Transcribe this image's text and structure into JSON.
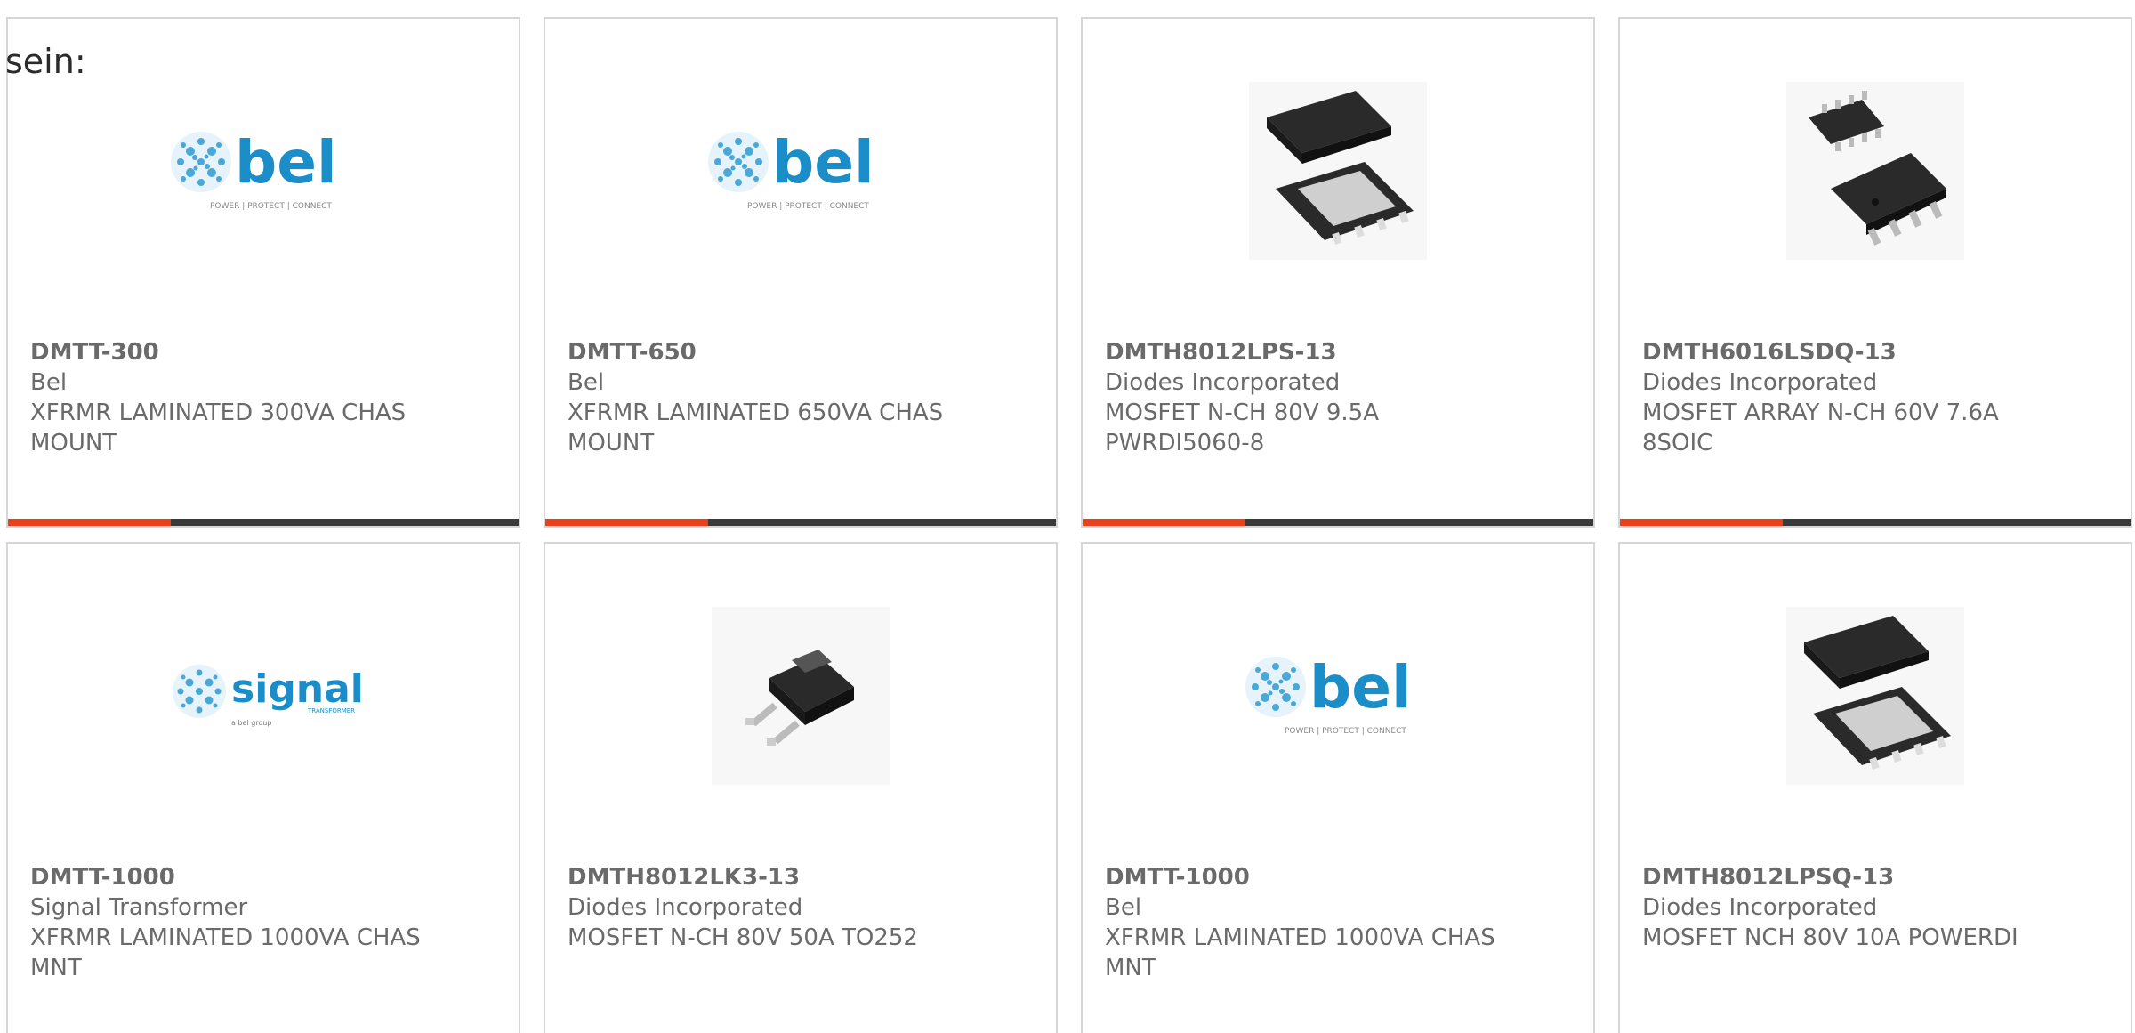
{
  "intro_text": "sein:",
  "colors": {
    "accent_bar": "#e8411d",
    "bar_dark": "#3a3a3a",
    "bel_blue": "#1b8ec9",
    "chip_dark": "#2a2a2a"
  },
  "products": [
    {
      "part": "DMTT-300",
      "maker": "Bel",
      "desc": "XFRMR LAMINATED 300VA CHAS MOUNT",
      "image": "bel-logo",
      "progress_fraction": 0.32
    },
    {
      "part": "DMTT-650",
      "maker": "Bel",
      "desc": "XFRMR LAMINATED 650VA CHAS MOUNT",
      "image": "bel-logo",
      "progress_fraction": 0.32
    },
    {
      "part": "DMTH8012LPS-13",
      "maker": "Diodes Incorporated",
      "desc": "MOSFET N-CH 80V 9.5A PWRDI5060-8",
      "image": "powerdi-chip",
      "progress_fraction": 0.32
    },
    {
      "part": "DMTH6016LSDQ-13",
      "maker": "Diodes Incorporated",
      "desc": "MOSFET ARRAY N-CH 60V 7.6A 8SOIC",
      "image": "soic-chip",
      "progress_fraction": 0.32
    },
    {
      "part": "DMTT-1000",
      "maker": "Signal Transformer",
      "desc": "XFRMR LAMINATED 1000VA CHAS MNT",
      "image": "signal-logo"
    },
    {
      "part": "DMTH8012LK3-13",
      "maker": "Diodes Incorporated",
      "desc": "MOSFET N-CH 80V 50A TO252",
      "image": "to252-chip"
    },
    {
      "part": "DMTT-1000",
      "maker": "Bel",
      "desc": "XFRMR LAMINATED 1000VA CHAS MNT",
      "image": "bel-logo"
    },
    {
      "part": "DMTH8012LPSQ-13",
      "maker": "Diodes Incorporated",
      "desc": "MOSFET NCH 80V 10A POWERDI",
      "image": "powerdi-chip"
    }
  ],
  "logos": {
    "bel": {
      "word": "bel",
      "tagline": "POWER | PROTECT | CONNECT"
    },
    "signal": {
      "word": "signal",
      "sub": "TRANSFORMER",
      "tagline": "a bel group"
    }
  }
}
